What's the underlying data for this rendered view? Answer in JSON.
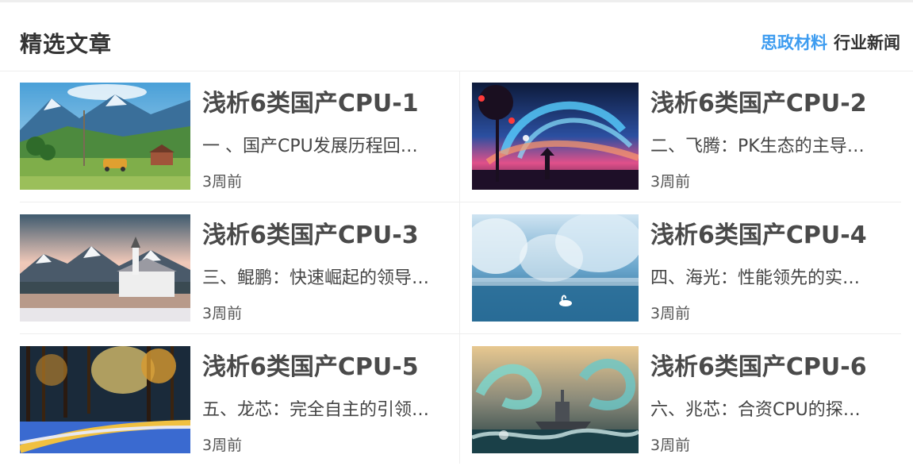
{
  "header": {
    "title": "精选文章",
    "tabs": [
      {
        "label": "思政材料",
        "active": true
      },
      {
        "label": "行业新闻",
        "active": false
      }
    ]
  },
  "colors": {
    "accent": "#3d9cf0",
    "title": "#333333",
    "divider": "#eeeeee"
  },
  "articles": [
    {
      "title": "浅析6类国产CPU-1",
      "desc": "一 、国产CPU发展历程回…",
      "time": "3周前",
      "image": "mountain-valley-landscape"
    },
    {
      "title": "浅析6类国产CPU-2",
      "desc": "二、飞腾：PK生态的主导…",
      "time": "3周前",
      "image": "fantasy-sky-figure"
    },
    {
      "title": "浅析6类国产CPU-3",
      "desc": "三、鲲鹏：快速崛起的领导…",
      "time": "3周前",
      "image": "church-snowy-mountains"
    },
    {
      "title": "浅析6类国产CPU-4",
      "desc": "四、海光：性能领先的实…",
      "time": "3周前",
      "image": "misty-lake-swan"
    },
    {
      "title": "浅析6类国产CPU-5",
      "desc": "五、龙芯：完全自主的引领…",
      "time": "3周前",
      "image": "snowy-forest-road"
    },
    {
      "title": "浅析6类国产CPU-6",
      "desc": "六、兆芯：合资CPU的探…",
      "time": "3周前",
      "image": "warship-dragon-sea"
    }
  ]
}
